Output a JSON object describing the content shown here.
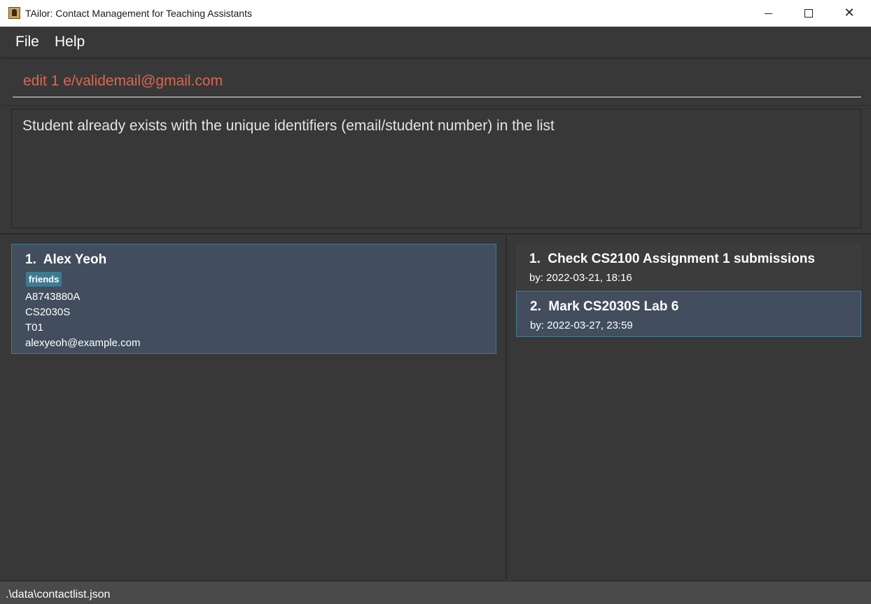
{
  "window": {
    "title": "TAilor: Contact Management for Teaching Assistants"
  },
  "menu": {
    "file": "File",
    "help": "Help"
  },
  "command": {
    "value": "edit 1 e/validemail@gmail.com",
    "text_color": "#d9674f"
  },
  "result": {
    "message": "Student already exists with the unique identifiers (email/student number) in the list"
  },
  "persons": [
    {
      "index": "1.",
      "name": "Alex Yeoh",
      "tags": [
        "friends"
      ],
      "student_id": "A8743880A",
      "module": "CS2030S",
      "tutorial": "T01",
      "email": "alexyeoh@example.com"
    }
  ],
  "tasks": [
    {
      "index": "1.",
      "title": "Check CS2100 Assignment 1 submissions",
      "due": "by: 2022-03-21, 18:16"
    },
    {
      "index": "2.",
      "title": "Mark CS2030S Lab 6",
      "due": "by: 2022-03-27, 23:59"
    }
  ],
  "status": {
    "file_path": ".\\data\\contactlist.json"
  },
  "colors": {
    "background": "#383838",
    "card_selected": "#424e5e",
    "accent": "#3e7b91"
  }
}
